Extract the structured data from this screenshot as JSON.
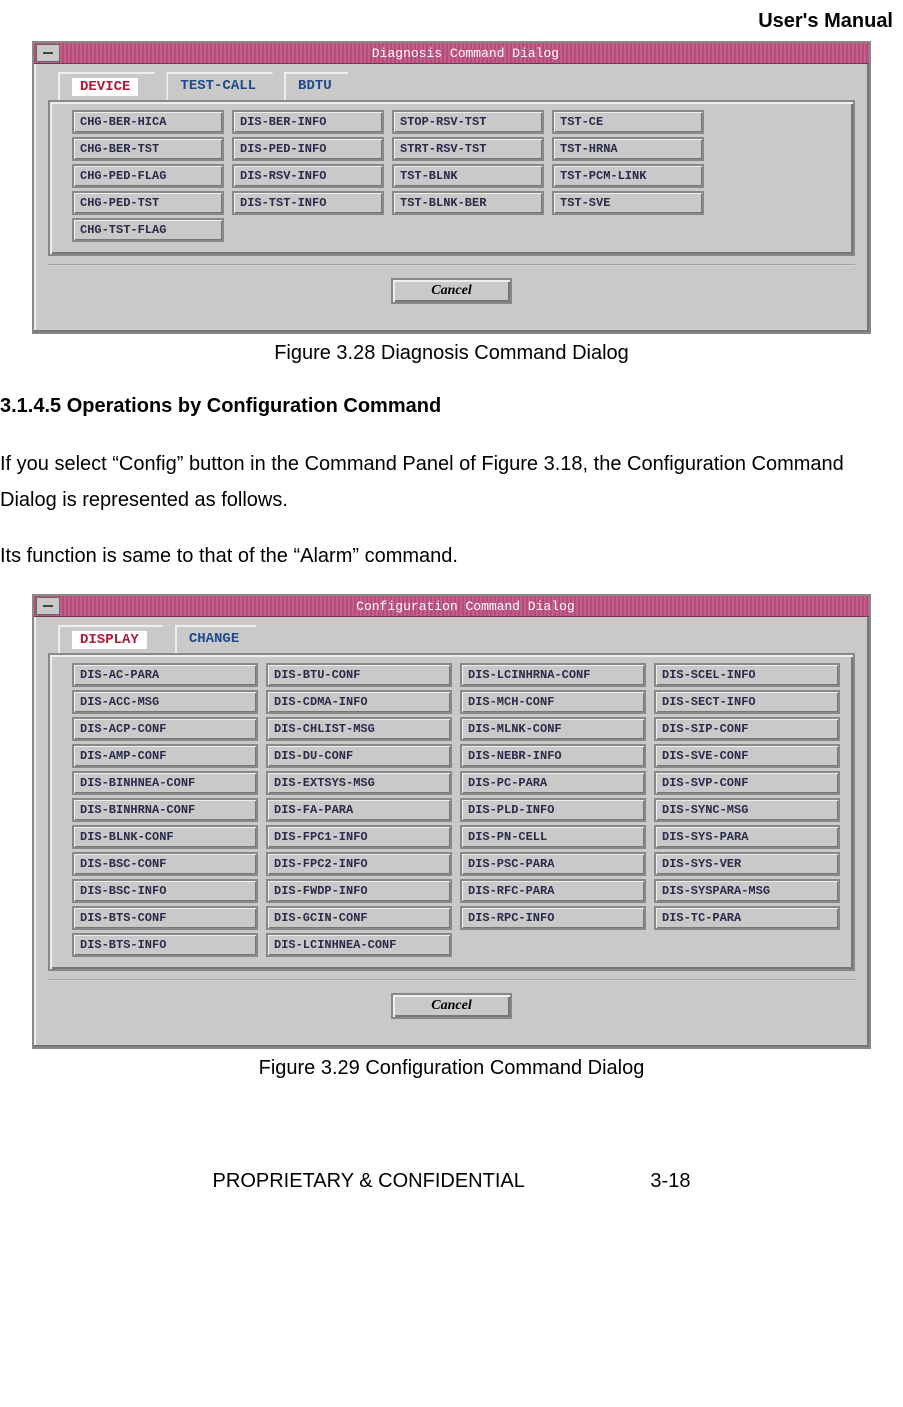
{
  "header": {
    "title": "User's Manual"
  },
  "dialog1": {
    "title": "Diagnosis Command Dialog",
    "tabs": [
      {
        "label": "DEVICE",
        "active": true
      },
      {
        "label": "TEST-CALL",
        "active": false
      },
      {
        "label": "BDTU",
        "active": false
      }
    ],
    "commands": [
      "CHG-BER-HICA",
      "DIS-BER-INFO",
      "STOP-RSV-TST",
      "TST-CE",
      "CHG-BER-TST",
      "DIS-PED-INFO",
      "STRT-RSV-TST",
      "TST-HRNA",
      "CHG-PED-FLAG",
      "DIS-RSV-INFO",
      "TST-BLNK",
      "TST-PCM-LINK",
      "CHG-PED-TST",
      "DIS-TST-INFO",
      "TST-BLNK-BER",
      "TST-SVE",
      "CHG-TST-FLAG"
    ],
    "cancel": "Cancel"
  },
  "caption1": "Figure 3.28 Diagnosis Command Dialog",
  "section_heading": "3.1.4.5 Operations by Configuration Command",
  "para1": "If you select “Config” button in the Command Panel of Figure 3.18, the Configuration Command Dialog is represented as follows.",
  "para2": "Its function is same to that of the “Alarm” command.",
  "dialog2": {
    "title": "Configuration Command Dialog",
    "tabs": [
      {
        "label": "DISPLAY",
        "active": true
      },
      {
        "label": "CHANGE",
        "active": false
      }
    ],
    "commands": [
      "DIS-AC-PARA",
      "DIS-BTU-CONF",
      "DIS-LCINHRNA-CONF",
      "DIS-SCEL-INFO",
      "DIS-ACC-MSG",
      "DIS-CDMA-INFO",
      "DIS-MCH-CONF",
      "DIS-SECT-INFO",
      "DIS-ACP-CONF",
      "DIS-CHLIST-MSG",
      "DIS-MLNK-CONF",
      "DIS-SIP-CONF",
      "DIS-AMP-CONF",
      "DIS-DU-CONF",
      "DIS-NEBR-INFO",
      "DIS-SVE-CONF",
      "DIS-BINHNEA-CONF",
      "DIS-EXTSYS-MSG",
      "DIS-PC-PARA",
      "DIS-SVP-CONF",
      "DIS-BINHRNA-CONF",
      "DIS-FA-PARA",
      "DIS-PLD-INFO",
      "DIS-SYNC-MSG",
      "DIS-BLNK-CONF",
      "DIS-FPC1-INFO",
      "DIS-PN-CELL",
      "DIS-SYS-PARA",
      "DIS-BSC-CONF",
      "DIS-FPC2-INFO",
      "DIS-PSC-PARA",
      "DIS-SYS-VER",
      "DIS-BSC-INFO",
      "DIS-FWDP-INFO",
      "DIS-RFC-PARA",
      "DIS-SYSPARA-MSG",
      "DIS-BTS-CONF",
      "DIS-GCIN-CONF",
      "DIS-RPC-INFO",
      "DIS-TC-PARA",
      "DIS-BTS-INFO",
      "DIS-LCINHNEA-CONF"
    ],
    "cancel": "Cancel"
  },
  "caption2": "Figure 3.29 Configuration Command Dialog",
  "footer": {
    "left": "PROPRIETARY & CONFIDENTIAL",
    "right": "3-18"
  }
}
